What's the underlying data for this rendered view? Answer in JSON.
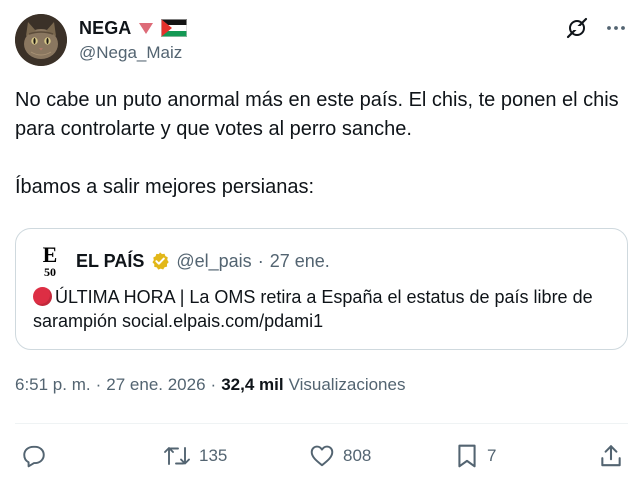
{
  "author": {
    "display_name": "NEGA",
    "handle": "@Nega_Maiz",
    "badges": [
      "red-down-triangle-icon",
      "palestine-flag-icon"
    ]
  },
  "top_actions": [
    "grok-icon",
    "more-icon"
  ],
  "tweet": {
    "text_line_1": "No cabe un puto anormal más en este país. El chis, te ponen el chis para controlarte y que votes al perro sanche.",
    "text_line_2": "Íbamos a salir mejores persianas:"
  },
  "quote": {
    "logo_letter": "E",
    "logo_number": "50",
    "name": "EL PAÍS",
    "verified": "gold-check-badge-icon",
    "handle": "@el_pais",
    "separator": "·",
    "date": "27 ene.",
    "text": "ÚLTIMA HORA | La OMS retira a España el estatus de país libre de sarampión social.elpais.com/pdami1"
  },
  "meta": {
    "time": "6:51 p. m.",
    "sep1": "·",
    "date": "27 ene. 2026",
    "sep2": "·",
    "views_count": "32,4 mil",
    "views_label": "Visualizaciones"
  },
  "actions": {
    "reply_count": "",
    "retweet_count": "135",
    "like_count": "808",
    "bookmark_count": "7"
  },
  "colors": {
    "text": "#0f1419",
    "secondary": "#536471",
    "border": "#cfd9de",
    "red_dot": "#dd2e44",
    "verified_gold": "#e2b719"
  }
}
